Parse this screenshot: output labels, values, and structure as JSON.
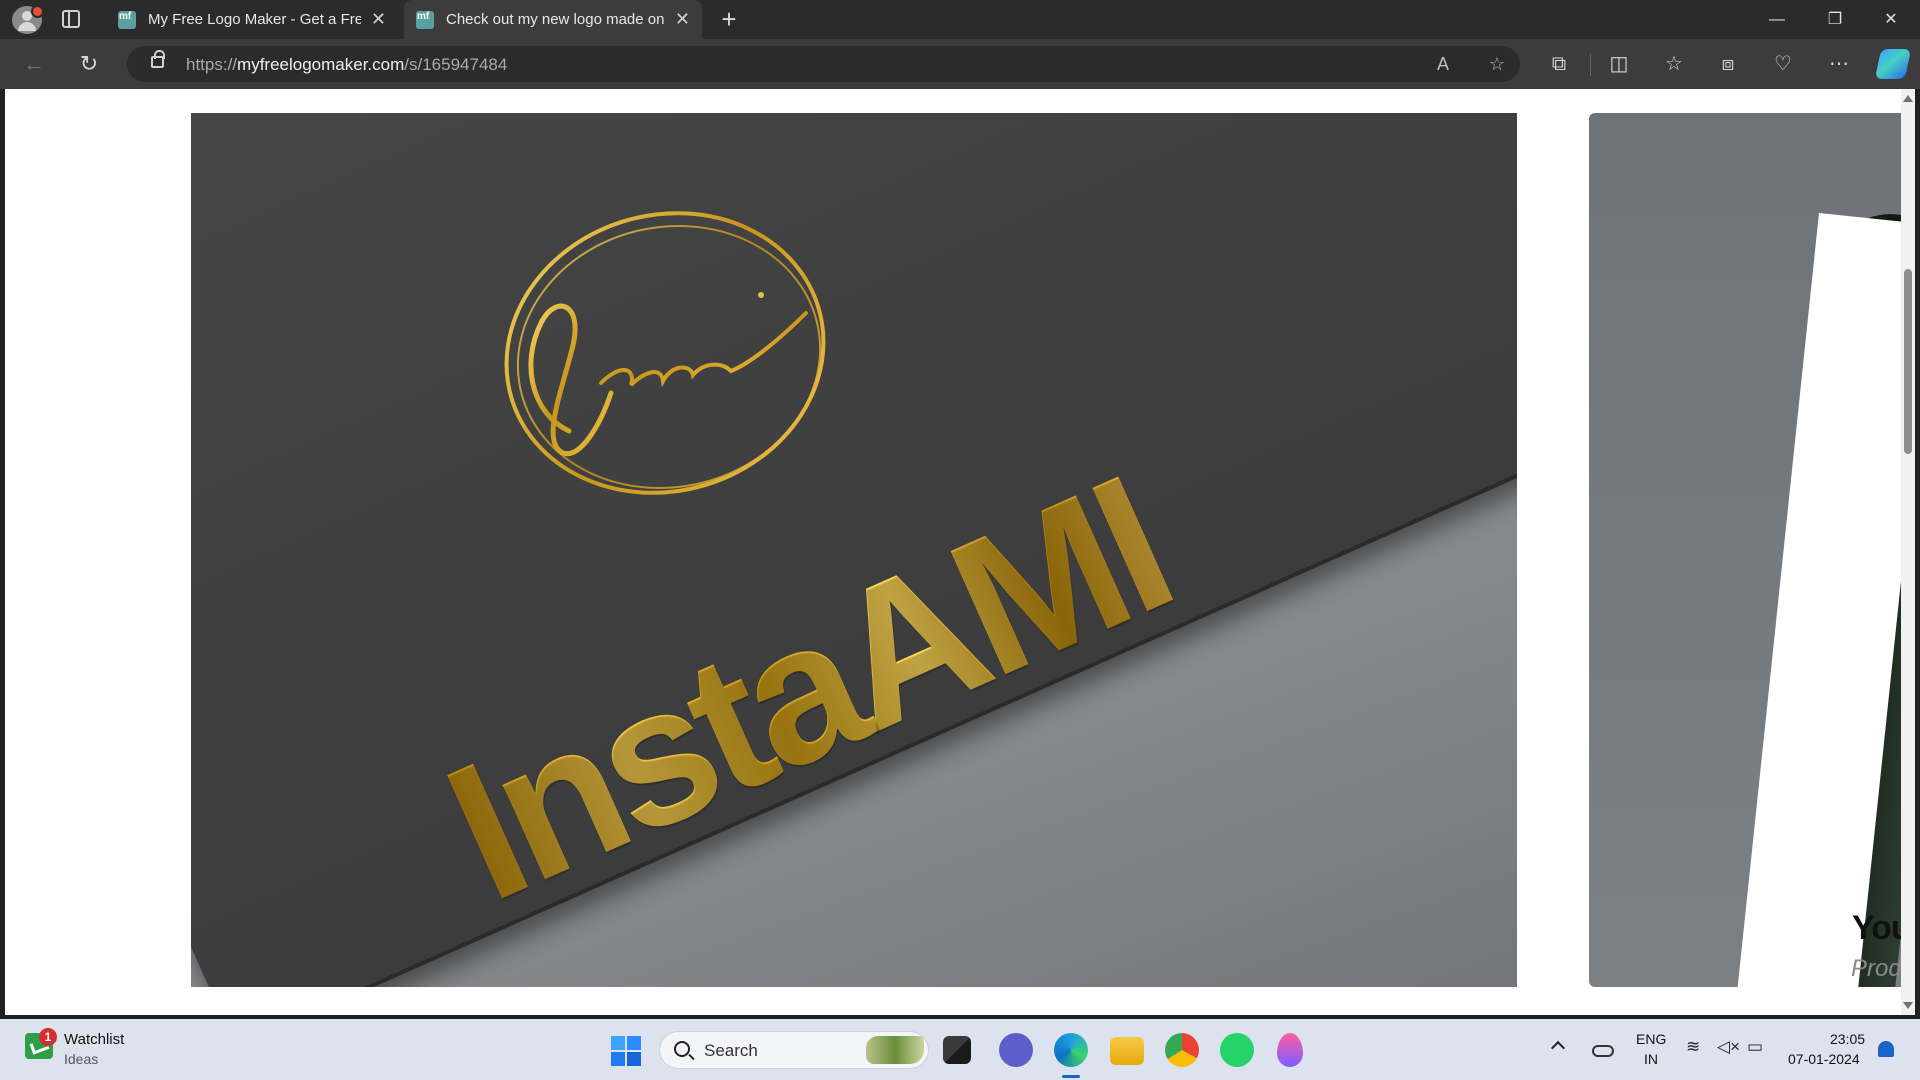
{
  "browser": {
    "tabs": [
      {
        "title": "My Free Logo Maker - Get a Free",
        "active": false
      },
      {
        "title": "Check out my new logo made on",
        "active": true
      }
    ],
    "address": {
      "url_prefix": "https://",
      "url_domain": "myfreelogomaker.com",
      "url_path": "/s/165947484"
    }
  },
  "page": {
    "logo_script": "Ami",
    "logo_brand": "InstaAMI",
    "ad_title": "You",
    "ad_subtitle": "Prod"
  },
  "taskbar": {
    "widget_title": "Watchlist",
    "widget_subtitle": "Ideas",
    "widget_badge": "1",
    "search_label": "Search",
    "lang_top": "ENG",
    "lang_bottom": "IN",
    "time": "23:05",
    "date": "07-01-2024"
  },
  "colors": {
    "gold": "#E1B23A",
    "browser_chrome": "#3C3C3C",
    "taskbar": "#DDE3EE"
  }
}
